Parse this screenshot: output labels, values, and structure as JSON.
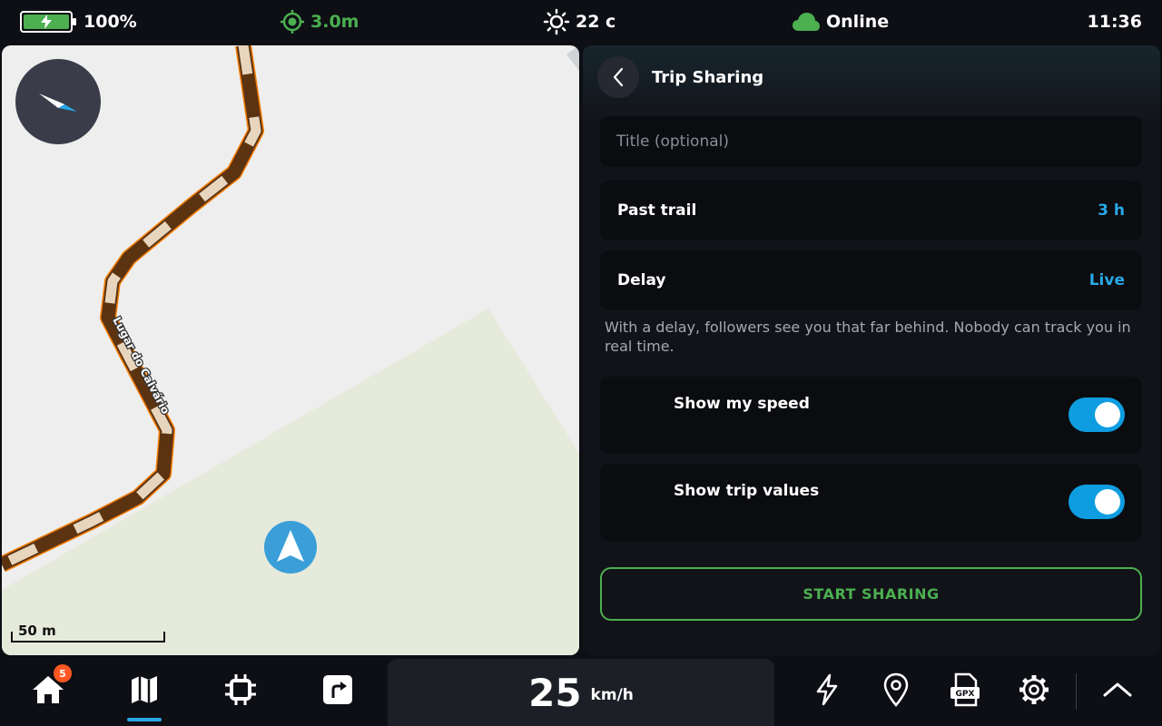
{
  "status_bar": {
    "battery": "100%",
    "gps_accuracy": "3.0m",
    "temperature": "22 c",
    "connection": "Online",
    "time": "11:36",
    "colors": {
      "battery_fill": "#4caf50",
      "gps": "#4caf50",
      "cloud": "#4caf50"
    }
  },
  "map": {
    "street_label": "Lugar do Calvário",
    "scale_label": "50 m"
  },
  "trip_sharing": {
    "title": "Trip Sharing",
    "title_placeholder": "Title (optional)",
    "past_trail": {
      "label": "Past trail",
      "value": "3 h"
    },
    "delay": {
      "label": "Delay",
      "value": "Live"
    },
    "hint": "With a delay, followers see you that far behind. Nobody can track you in real time.",
    "show_speed": {
      "label": "Show my speed",
      "enabled": true
    },
    "show_trip_values": {
      "label": "Show trip values",
      "enabled": true
    },
    "start_button": "START SHARING",
    "colors": {
      "accent": "#29a8e6",
      "toggle_on": "#0e9de0",
      "start": "#4caf50"
    }
  },
  "bottom_bar": {
    "home_badge": "5",
    "speed": "25",
    "speed_unit": "km/h",
    "icons": [
      "home-icon",
      "map-icon",
      "chip-icon",
      "turn-right-icon",
      "bolt-icon",
      "location-pin-icon",
      "gpx-file-icon",
      "gear-icon",
      "chevron-up-icon"
    ],
    "active_tab": "map"
  }
}
